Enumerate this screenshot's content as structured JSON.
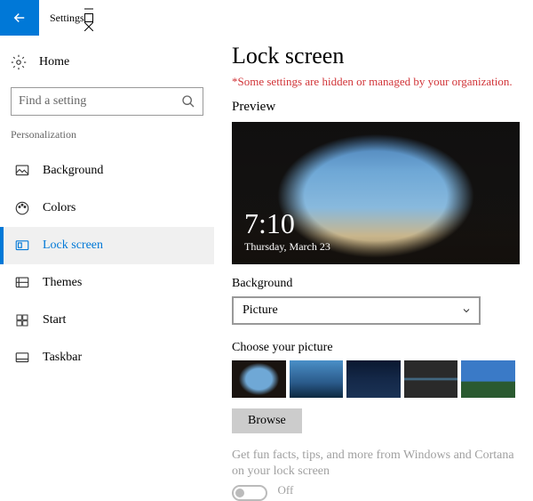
{
  "app_title": "Settings",
  "search": {
    "placeholder": "Find a setting"
  },
  "sidebar": {
    "home_label": "Home",
    "category": "Personalization",
    "items": [
      {
        "label": "Background"
      },
      {
        "label": "Colors"
      },
      {
        "label": "Lock screen"
      },
      {
        "label": "Themes"
      },
      {
        "label": "Start"
      },
      {
        "label": "Taskbar"
      }
    ]
  },
  "main": {
    "title": "Lock screen",
    "warning": "*Some settings are hidden or managed by your organization.",
    "preview_label": "Preview",
    "preview_time": "7:10",
    "preview_date": "Thursday, March 23",
    "background_label": "Background",
    "background_value": "Picture",
    "choose_label": "Choose your picture",
    "browse_label": "Browse",
    "fun_facts_label": "Get fun facts, tips, and more from Windows and Cortana on your lock screen",
    "fun_facts_state": "Off"
  }
}
